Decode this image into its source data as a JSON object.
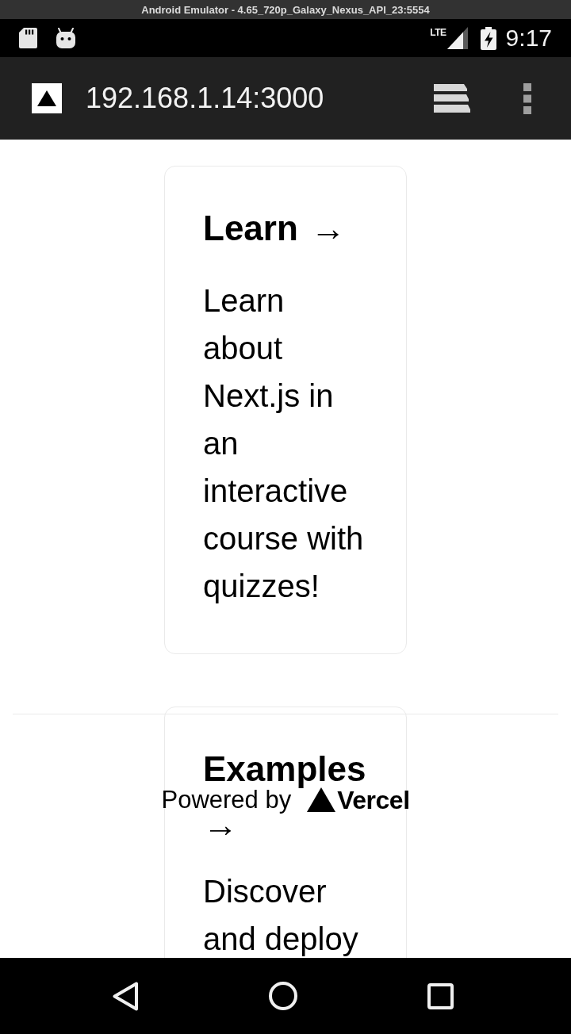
{
  "window": {
    "title": "Android Emulator - 4.65_720p_Galaxy_Nexus_API_23:5554"
  },
  "status_bar": {
    "network": "LTE",
    "time": "9:17"
  },
  "browser_toolbar": {
    "url": "192.168.1.14:3000"
  },
  "cards": [
    {
      "title": "Learn",
      "arrow": "→",
      "description": "Learn about Next.js in an interactive course with quizzes!"
    },
    {
      "title": "Examples",
      "arrow": "→",
      "description": "Discover and deploy"
    }
  ],
  "footer": {
    "text": "Powered by",
    "brand": "Vercel"
  }
}
